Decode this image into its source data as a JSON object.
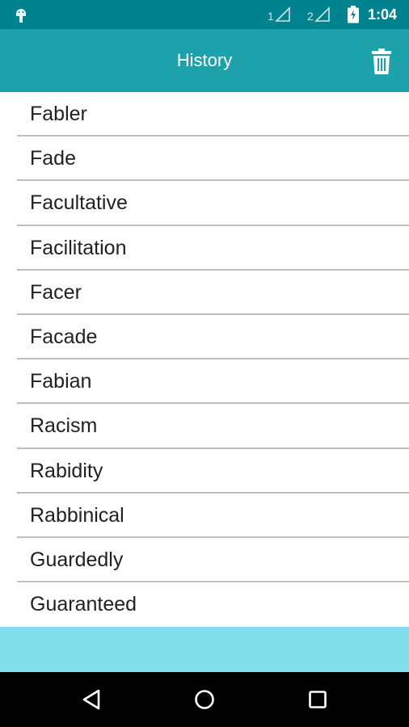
{
  "status_bar": {
    "sim1": "1",
    "sim2": "2",
    "time": "1:04"
  },
  "app_bar": {
    "title": "History",
    "accent_color": "#1da2ab",
    "status_color": "#00838f"
  },
  "history": {
    "items": [
      "Fabler",
      "Fade",
      "Facultative",
      "Facilitation",
      "Facer",
      "Facade",
      "Fabian",
      "Racism",
      "Rabidity",
      "Rabbinical",
      "Guardedly",
      "Guaranteed"
    ]
  },
  "footer": {
    "band_color": "#80deea"
  },
  "icons": {
    "status_left": "android-icon",
    "signal": "signal-icon",
    "battery": "battery-charging-icon",
    "delete": "trash-icon",
    "nav_back": "back-icon",
    "nav_home": "home-icon",
    "nav_recents": "recents-icon"
  }
}
